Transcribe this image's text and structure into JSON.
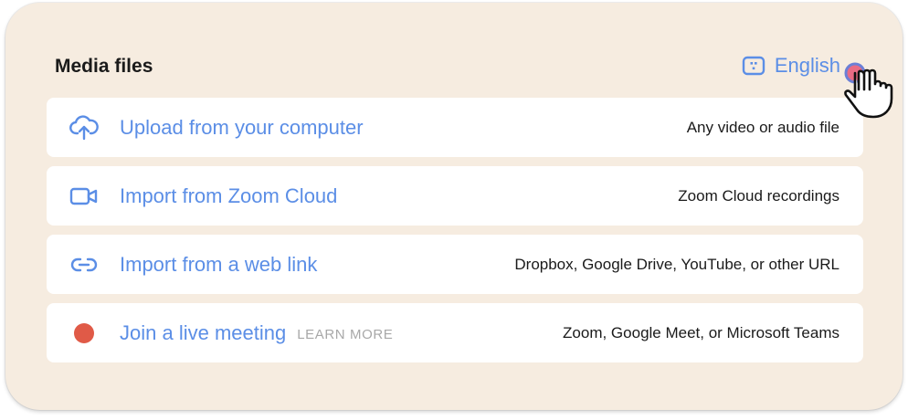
{
  "header": {
    "title": "Media files",
    "language_label": "English"
  },
  "rows": [
    {
      "label": "Upload from your computer",
      "description": "Any video or audio file",
      "icon": "cloud-upload-icon"
    },
    {
      "label": "Import from Zoom Cloud",
      "description": "Zoom Cloud recordings",
      "icon": "video-camera-icon"
    },
    {
      "label": "Import from a web link",
      "description": "Dropbox, Google Drive, YouTube, or other URL",
      "icon": "link-icon"
    },
    {
      "label": "Join a live meeting",
      "extra_link": "LEARN MORE",
      "description": "Zoom, Google Meet, or Microsoft Teams",
      "icon": "record-dot-icon"
    }
  ],
  "colors": {
    "card_background": "#f6ece0",
    "accent_blue": "#5b8ee6",
    "record_red": "#e05a47",
    "text_dark": "#1a1a1a",
    "muted_gray": "#a8a8a8"
  }
}
